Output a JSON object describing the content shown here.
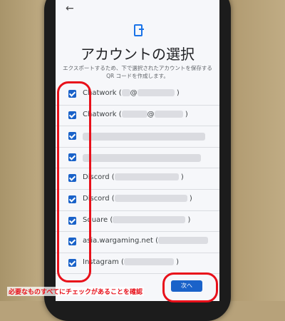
{
  "screen": {
    "title": "アカウントの選択",
    "description": "エクスポートするため、下で選択されたアカウントを保存する QR コードを作成します。",
    "next_label": "次へ"
  },
  "accounts": [
    {
      "name": "Chatwork (",
      "mid": "@",
      "end": ")"
    },
    {
      "name": "Chatwork (",
      "mid": "@",
      "end": ")"
    },
    {
      "name": "",
      "mid": "",
      "end": ""
    },
    {
      "name": "",
      "mid": "",
      "end": ""
    },
    {
      "name": "Discord (",
      "mid": "",
      "end": ")"
    },
    {
      "name": "Discord (",
      "mid": "",
      "end": ")"
    },
    {
      "name": "Square (",
      "mid": "",
      "end": ")"
    },
    {
      "name": "asia.wargaming.net (",
      "mid": "",
      "end": ""
    },
    {
      "name": "Instagram (",
      "mid": "",
      "end": ")"
    }
  ],
  "annotation": {
    "caption": "必要なものすべてにチェックがあることを確認",
    "color": "#e8101a"
  },
  "colors": {
    "accent": "#1a62c9"
  }
}
